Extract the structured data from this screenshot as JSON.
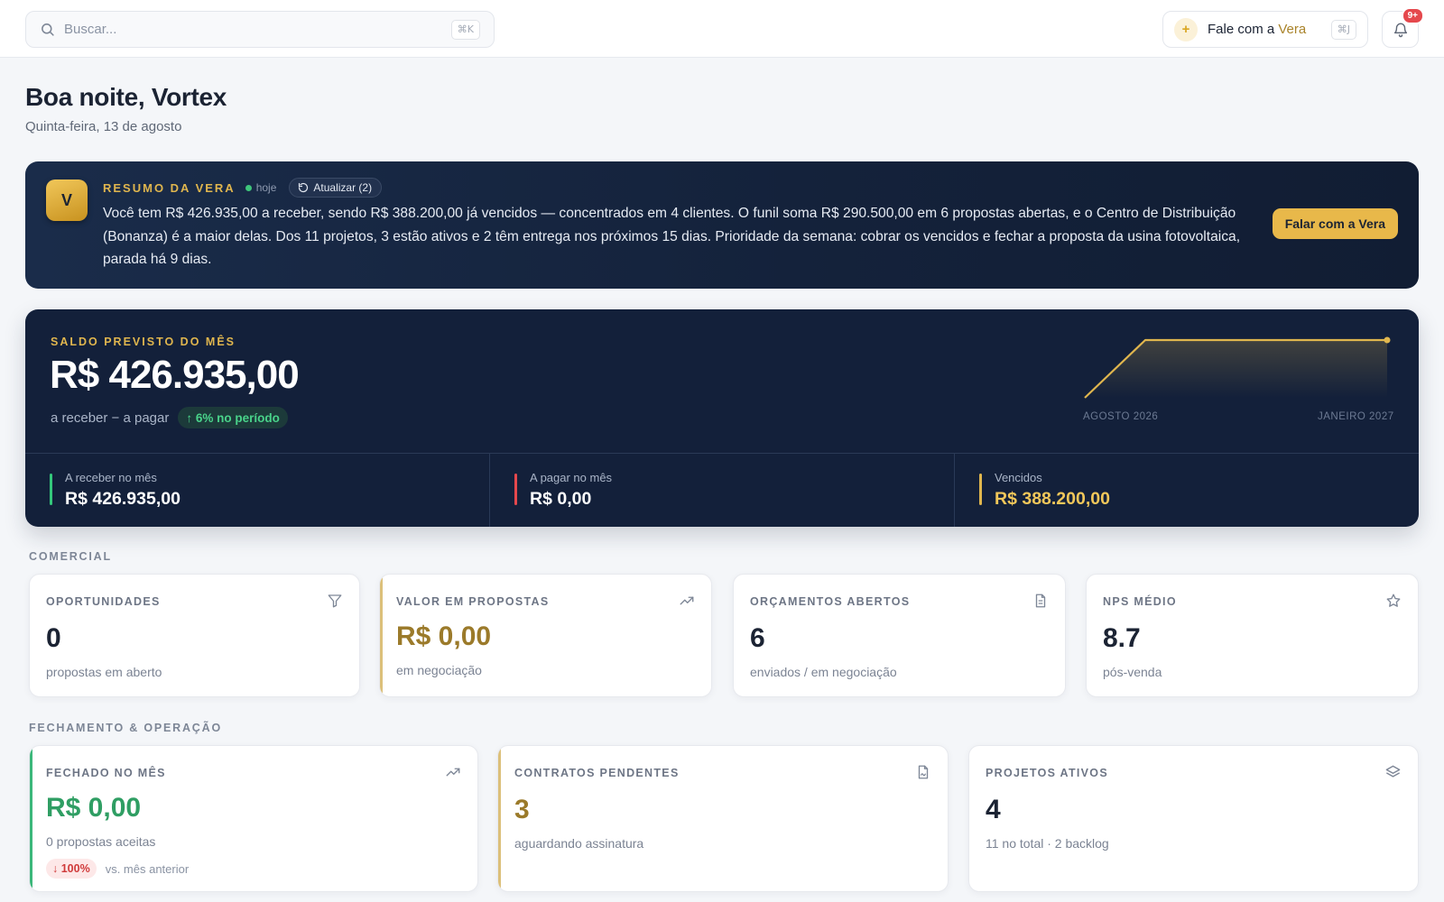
{
  "topbar": {
    "search_placeholder": "Buscar...",
    "search_shortcut": "⌘K",
    "vera_label_prefix": "Fale com a",
    "vera_label_name": "Vera",
    "vera_shortcut": "⌘J",
    "notifications_badge": "9+"
  },
  "greeting": {
    "title": "Boa noite, Vortex",
    "date": "Quinta-feira, 13 de agosto"
  },
  "vera_summary": {
    "avatar_letter": "V",
    "title": "RESUMO DA VERA",
    "when": "hoje",
    "refresh_label": "Atualizar (2)",
    "text": "Você tem R$ 426.935,00 a receber, sendo R$ 388.200,00 já vencidos — concentrados em 4 clientes. O funil soma R$ 290.500,00 em 6 propostas abertas, e o Centro de Distribuição (Bonanza) é a maior delas. Dos 11 projetos, 3 estão ativos e 2 têm entrega nos próximos 15 dias. Prioridade da semana: cobrar os vencidos e fechar a proposta da usina fotovoltaica, parada há 9 dias.",
    "cta_label": "Falar com a Vera"
  },
  "balance": {
    "label": "SALDO PREVISTO DO MÊS",
    "value": "R$ 426.935,00",
    "formula": "a receber − a pagar",
    "change": "↑ 6% no período",
    "spark_start_label": "AGOSTO 2026",
    "spark_end_label": "JANEIRO 2027",
    "sparkline": [
      0,
      1,
      1,
      1,
      1,
      1
    ],
    "stats": [
      {
        "label": "A receber no mês",
        "value": "R$ 426.935,00",
        "color": "#34c77b",
        "value_color": "#ffffff"
      },
      {
        "label": "A pagar no mês",
        "value": "R$ 0,00",
        "color": "#e5484d",
        "value_color": "#ffffff"
      },
      {
        "label": "Vencidos",
        "value": "R$ 388.200,00",
        "color": "#e0b64e",
        "value_color": "#f1c75a"
      }
    ]
  },
  "comercial": {
    "section_title": "COMERCIAL",
    "cards": [
      {
        "title": "OPORTUNIDADES",
        "value": "0",
        "sub": "propostas em aberto",
        "icon": "funnel-icon"
      },
      {
        "title": "VALOR EM PROPOSTAS",
        "value": "R$ 0,00",
        "sub": "em negociação",
        "icon": "trending-up-icon"
      },
      {
        "title": "ORÇAMENTOS ABERTOS",
        "value": "6",
        "sub": "enviados / em negociação",
        "icon": "document-icon"
      },
      {
        "title": "NPS MÉDIO",
        "value": "8.7",
        "sub": "pós-venda",
        "icon": "star-icon"
      }
    ]
  },
  "operacao": {
    "section_title": "FECHAMENTO & OPERAÇÃO",
    "cards": [
      {
        "title": "FECHADO NO MÊS",
        "value": "R$ 0,00",
        "sub": "0 propostas aceitas",
        "trend": "↓ 100%",
        "trend_note": "vs. mês anterior",
        "icon": "trending-up-icon"
      },
      {
        "title": "CONTRATOS PENDENTES",
        "value": "3",
        "sub": "aguardando assinatura",
        "icon": "contract-icon"
      },
      {
        "title": "PROJETOS ATIVOS",
        "value": "4",
        "sub": "11 no total · 2 backlog",
        "icon": "layers-icon"
      }
    ]
  },
  "colors": {
    "navy": "#13203a",
    "gold": "#e0b64e",
    "gold_dark": "#a9832a",
    "green": "#2f9e63",
    "red": "#e5484d"
  }
}
